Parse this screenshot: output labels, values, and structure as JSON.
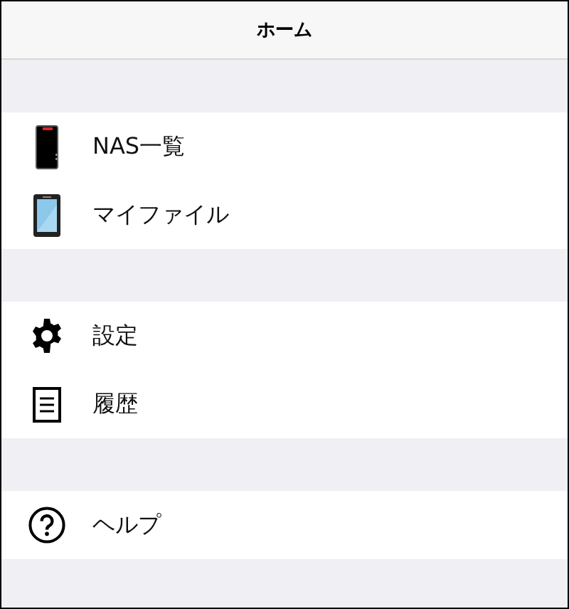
{
  "header": {
    "title": "ホーム"
  },
  "sections": [
    {
      "items": [
        {
          "label": "NAS一覧",
          "kind": "nas"
        },
        {
          "label": "マイファイル",
          "kind": "tablet"
        }
      ]
    },
    {
      "items": [
        {
          "label": "設定",
          "kind": "settings"
        },
        {
          "label": "履歴",
          "kind": "history"
        }
      ]
    },
    {
      "items": [
        {
          "label": "ヘルプ",
          "kind": "help"
        }
      ]
    }
  ]
}
